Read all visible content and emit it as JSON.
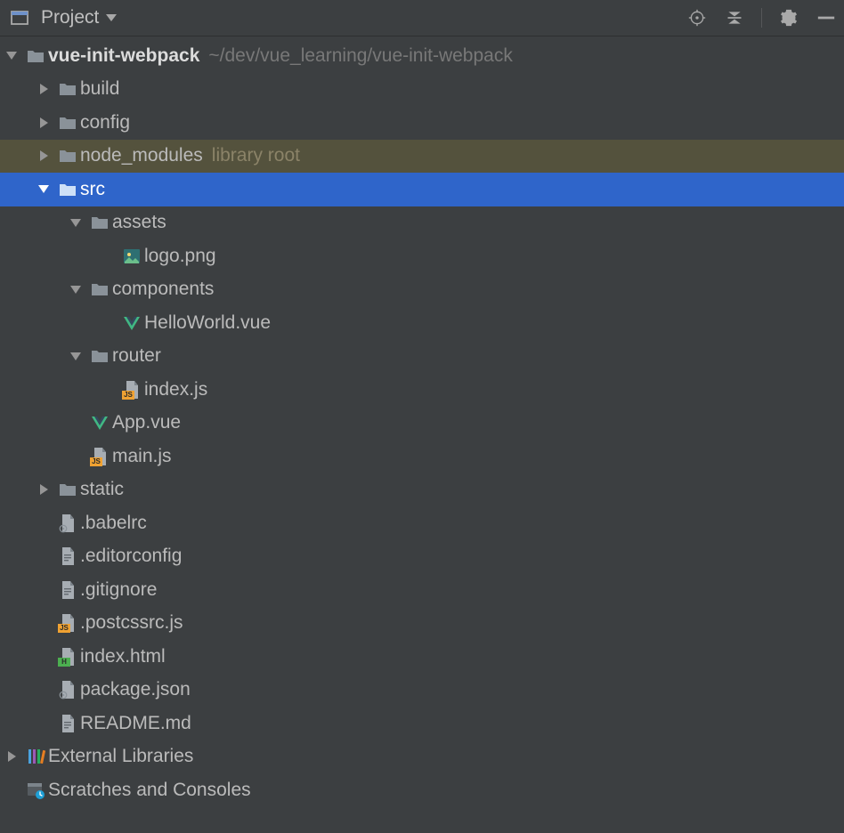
{
  "header": {
    "title": "Project"
  },
  "tree": {
    "root": {
      "name": "vue-init-webpack",
      "path": "~/dev/vue_learning/vue-init-webpack"
    },
    "build": {
      "name": "build"
    },
    "config": {
      "name": "config"
    },
    "node_modules": {
      "name": "node_modules",
      "hint": "library root"
    },
    "src": {
      "name": "src"
    },
    "assets": {
      "name": "assets"
    },
    "logo_png": {
      "name": "logo.png"
    },
    "components": {
      "name": "components"
    },
    "hello_vue": {
      "name": "HelloWorld.vue"
    },
    "router": {
      "name": "router"
    },
    "index_js": {
      "name": "index.js"
    },
    "app_vue": {
      "name": "App.vue"
    },
    "main_js": {
      "name": "main.js"
    },
    "static": {
      "name": "static"
    },
    "babelrc": {
      "name": ".babelrc"
    },
    "editorconfig": {
      "name": ".editorconfig"
    },
    "gitignore": {
      "name": ".gitignore"
    },
    "postcssrc_js": {
      "name": ".postcssrc.js"
    },
    "index_html": {
      "name": "index.html"
    },
    "package_json": {
      "name": "package.json"
    },
    "readme_md": {
      "name": "README.md"
    },
    "external_libs": {
      "name": "External Libraries"
    },
    "scratches": {
      "name": "Scratches and Consoles"
    }
  }
}
